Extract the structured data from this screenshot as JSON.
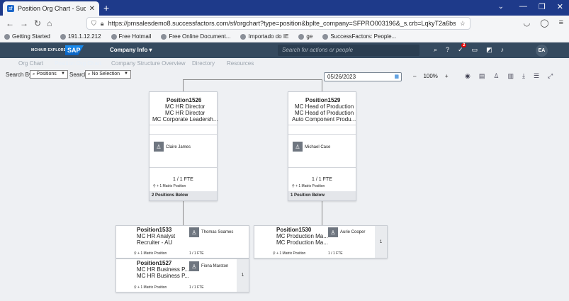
{
  "browser": {
    "tab_title": "Position Org Chart - SuccessFac",
    "tab_close": "✕",
    "new_tab": "+",
    "tab_list": "⌄",
    "window": {
      "minimize": "—",
      "restore": "❐",
      "close": "✕"
    },
    "url": "https://pmsalesdemo8.successfactors.com/sf/orgchart?type=position&bplte_company=SFPRO003196&_s.crb=LqkyT2a6bs0oJqothsi6%252fNRQj2RYp",
    "bookmarks": [
      "Getting Started",
      "191.1.12.212",
      "Free Hotmail",
      "Free Online Document...",
      "Importado do IE",
      "ge",
      "SuccessFactors: People..."
    ]
  },
  "shell": {
    "brand_small": "MCHAIR EXPLORE",
    "logo_text": "SAP",
    "company_menu": "Company Info ▾",
    "search_placeholder": "Search for actions or people",
    "notification_count": "2",
    "avatar_initials": "EA"
  },
  "subnav": {
    "tabs": [
      "Org Chart",
      "Position Org Chart",
      "Company Structure Overview",
      "Directory",
      "Resources"
    ]
  },
  "toolbar": {
    "search_by_label": "Search By",
    "search_by_value": "Positions",
    "search_label": "Search",
    "search_value": "No Selection",
    "date": "05/26/2023",
    "zoom_out": "–",
    "zoom_level": "100%",
    "zoom_in": "+"
  },
  "chart": {
    "top": [
      {
        "title": "Position1526",
        "lines": [
          "MC HR Director",
          "MC HR Director",
          "MC Corporate Leadersh..."
        ],
        "person": "Claire James",
        "fte": "1 / 1 FTE",
        "matrix": "+ 1 Matrix Position",
        "below": "2 Positions Below"
      },
      {
        "title": "Position1529",
        "lines": [
          "MC Head of Production",
          "MC Head of Production",
          "Auto Component Produ..."
        ],
        "person": "Michael Case",
        "fte": "1 / 1 FTE",
        "matrix": "+ 1 Matrix Position",
        "below": "1 Position Below"
      }
    ],
    "children": [
      {
        "title": "Position1533",
        "lines": [
          "MC HR Analyst",
          "Recruiter - AU"
        ],
        "person": "Thomas Soames",
        "matrix": "+ 1 Matrix Position",
        "fte": "1 / 1 FTE"
      },
      {
        "title": "Position1527",
        "lines": [
          "MC HR Business P...",
          "MC HR Business P..."
        ],
        "person": "Fiona Marston",
        "matrix": "+ 1 Matrix Position",
        "fte": "1 / 1 FTE",
        "count": "1"
      },
      {
        "title": "Position1530",
        "lines": [
          "MC Production Ma...",
          "MC Production Ma..."
        ],
        "person": "Aurie Cooper",
        "matrix": "+ 1 Matrix Position",
        "fte": "1 / 1 FTE",
        "count": "1"
      }
    ]
  }
}
